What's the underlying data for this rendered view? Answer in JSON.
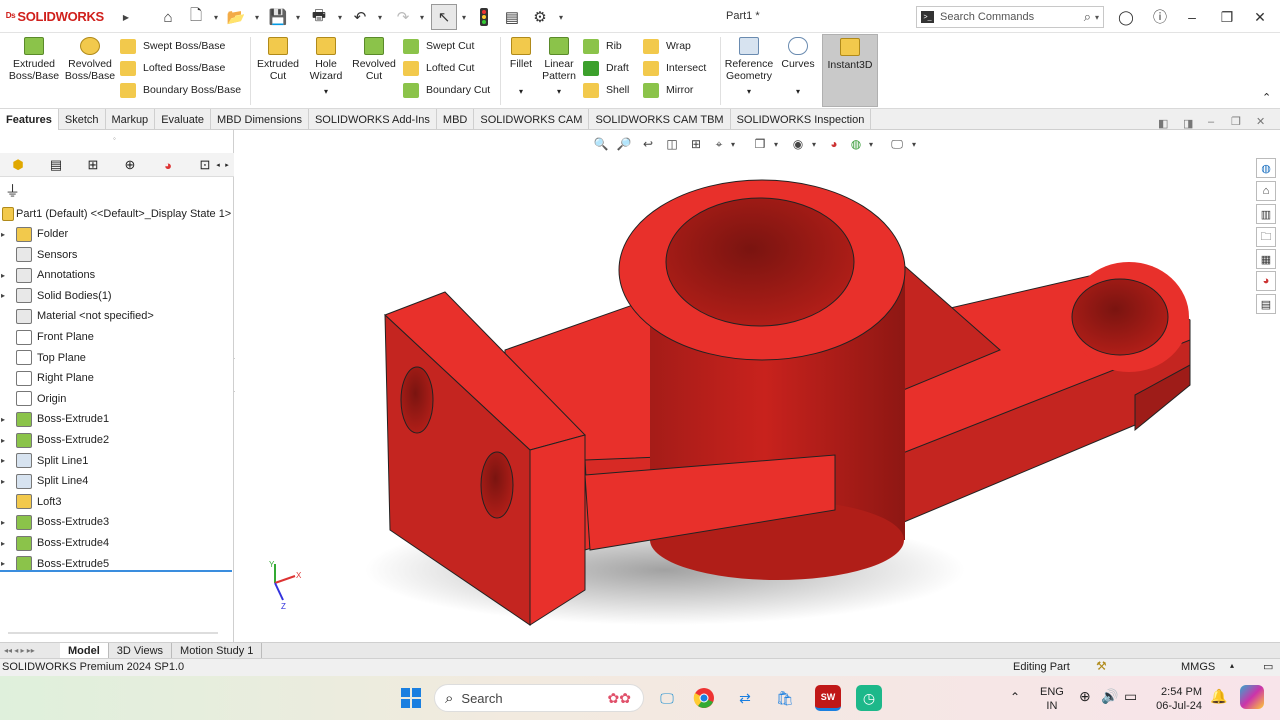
{
  "app": {
    "logo_text": "SOLIDWORKS",
    "document_title": "Part1 *"
  },
  "search": {
    "placeholder": "Search Commands"
  },
  "ribbon": {
    "extruded_boss": "Extruded Boss/Base",
    "revolved_boss": "Revolved Boss/Base",
    "swept_boss": "Swept Boss/Base",
    "lofted_boss": "Lofted Boss/Base",
    "boundary_boss": "Boundary Boss/Base",
    "extruded_cut": "Extruded Cut",
    "hole_wizard": "Hole Wizard",
    "revolved_cut": "Revolved Cut",
    "swept_cut": "Swept Cut",
    "lofted_cut": "Lofted Cut",
    "boundary_cut": "Boundary Cut",
    "fillet": "Fillet",
    "linear_pattern": "Linear Pattern",
    "rib": "Rib",
    "draft": "Draft",
    "shell": "Shell",
    "wrap": "Wrap",
    "intersect": "Intersect",
    "mirror": "Mirror",
    "reference_geometry": "Reference Geometry",
    "curves": "Curves",
    "instant3d": "Instant3D"
  },
  "command_tabs": [
    "Features",
    "Sketch",
    "Markup",
    "Evaluate",
    "MBD Dimensions",
    "SOLIDWORKS Add-Ins",
    "MBD",
    "SOLIDWORKS CAM",
    "SOLIDWORKS CAM TBM",
    "SOLIDWORKS Inspection"
  ],
  "tree": {
    "root": "Part1 (Default) <<Default>_Display State 1>",
    "items": [
      {
        "label": "Folder",
        "icon": "folder-icon",
        "color": "#f2c94c",
        "expandable": true
      },
      {
        "label": "Sensors",
        "icon": "sensor-icon",
        "color": "#e8e8e8",
        "expandable": false
      },
      {
        "label": "Annotations",
        "icon": "annotation-icon",
        "color": "#e8e8e8",
        "expandable": true
      },
      {
        "label": "Solid Bodies(1)",
        "icon": "solid-bodies-icon",
        "color": "#e8e8e8",
        "expandable": true
      },
      {
        "label": "Material <not specified>",
        "icon": "material-icon",
        "color": "#e8e8e8",
        "expandable": false
      },
      {
        "label": "Front Plane",
        "icon": "plane-icon",
        "color": "#ffffff",
        "expandable": false
      },
      {
        "label": "Top Plane",
        "icon": "plane-icon",
        "color": "#ffffff",
        "expandable": false
      },
      {
        "label": "Right Plane",
        "icon": "plane-icon",
        "color": "#ffffff",
        "expandable": false
      },
      {
        "label": "Origin",
        "icon": "origin-icon",
        "color": "#ffffff",
        "expandable": false
      },
      {
        "label": "Boss-Extrude1",
        "icon": "extrude-icon",
        "color": "#8bc34a",
        "expandable": true
      },
      {
        "label": "Boss-Extrude2",
        "icon": "extrude-icon",
        "color": "#8bc34a",
        "expandable": true
      },
      {
        "label": "Split Line1",
        "icon": "split-line-icon",
        "color": "#d7e3f0",
        "expandable": true
      },
      {
        "label": "Split Line4",
        "icon": "split-line-icon",
        "color": "#d7e3f0",
        "expandable": true
      },
      {
        "label": "Loft3",
        "icon": "loft-icon",
        "color": "#f2c94c",
        "expandable": false
      },
      {
        "label": "Boss-Extrude3",
        "icon": "extrude-icon",
        "color": "#8bc34a",
        "expandable": true
      },
      {
        "label": "Boss-Extrude4",
        "icon": "extrude-icon",
        "color": "#8bc34a",
        "expandable": true
      },
      {
        "label": "Boss-Extrude5",
        "icon": "extrude-icon",
        "color": "#8bc34a",
        "expandable": true
      }
    ]
  },
  "bottom_tabs": [
    "Model",
    "3D Views",
    "Motion Study 1"
  ],
  "status": {
    "version": "SOLIDWORKS Premium 2024 SP1.0",
    "mode": "Editing Part",
    "units": "MMGS"
  },
  "triad": {
    "x": "X",
    "y": "Y",
    "z": "Z"
  },
  "taskbar": {
    "search": "Search",
    "lang1": "ENG",
    "lang2": "IN",
    "time": "2:54 PM",
    "date": "06-Jul-24"
  },
  "colors": {
    "part": "#e8302b",
    "accent": "#d0201c",
    "selection": "#3a8dde"
  }
}
